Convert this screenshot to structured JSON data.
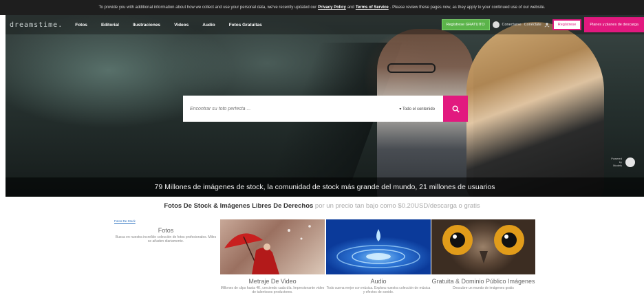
{
  "notice": {
    "text_before": "To provide you with additional information about how we collect and use your personal data, we've recently updated our",
    "privacy_link": "Privacy Policy",
    "and": "and",
    "terms_link": "Terms of Service",
    "text_after": ". Please review these pages now, as they apply to your continued use of our website."
  },
  "header": {
    "logo": "dreamstime.",
    "nav": [
      "Fotos",
      "Editorial",
      "Ilustraciones",
      "Videos",
      "Audio",
      "Fotos Gratuitas"
    ],
    "register_free": "Regístrese GRATUITO",
    "login": "Conectarse",
    "connected_label": "Conéctate",
    "register": "Regístrese",
    "plans_button": "Planes y planes de descarga"
  },
  "search": {
    "placeholder": "Encontrar su foto perfecta ...",
    "scope_label": "Todo el contenido",
    "scope_icon": "chevron-down-icon",
    "button_icon": "search-icon"
  },
  "hero": {
    "powered_by_line1": "Powered by",
    "powered_by_line2": "Models"
  },
  "stats_bar": "79 Millones de imágenes de stock, la comunidad de stock más grande del mundo, 21 millones de usuarios",
  "headline": {
    "bold": "Fotos De Stock & Imágenes Libres De Derechos",
    "rest": " por un precio tan bajo como $0.20USD/descarga o gratis"
  },
  "categories": {
    "fotos": {
      "image_alt": "Fotos De Stock",
      "title": "Fotos",
      "desc": "Busca en nuestra increíble colección de fotos profesionales. Miles se añaden diariamente."
    },
    "video": {
      "title": "Metraje De Video",
      "desc": "Millones de clips hasta 4K, creciendo cada día. Impresionante video de talentosos productores."
    },
    "audio": {
      "title": "Audio",
      "desc": "Todo suena mejor con música. Explora nuestra colección de música y efectos de sonido."
    },
    "free": {
      "title": "Gratuita & Dominio Público Imágenes",
      "desc": "Descubre un mundo de imágenes gratis"
    }
  },
  "colors": {
    "accent_pink": "#e2197f",
    "register_green": "#5bb44a"
  }
}
